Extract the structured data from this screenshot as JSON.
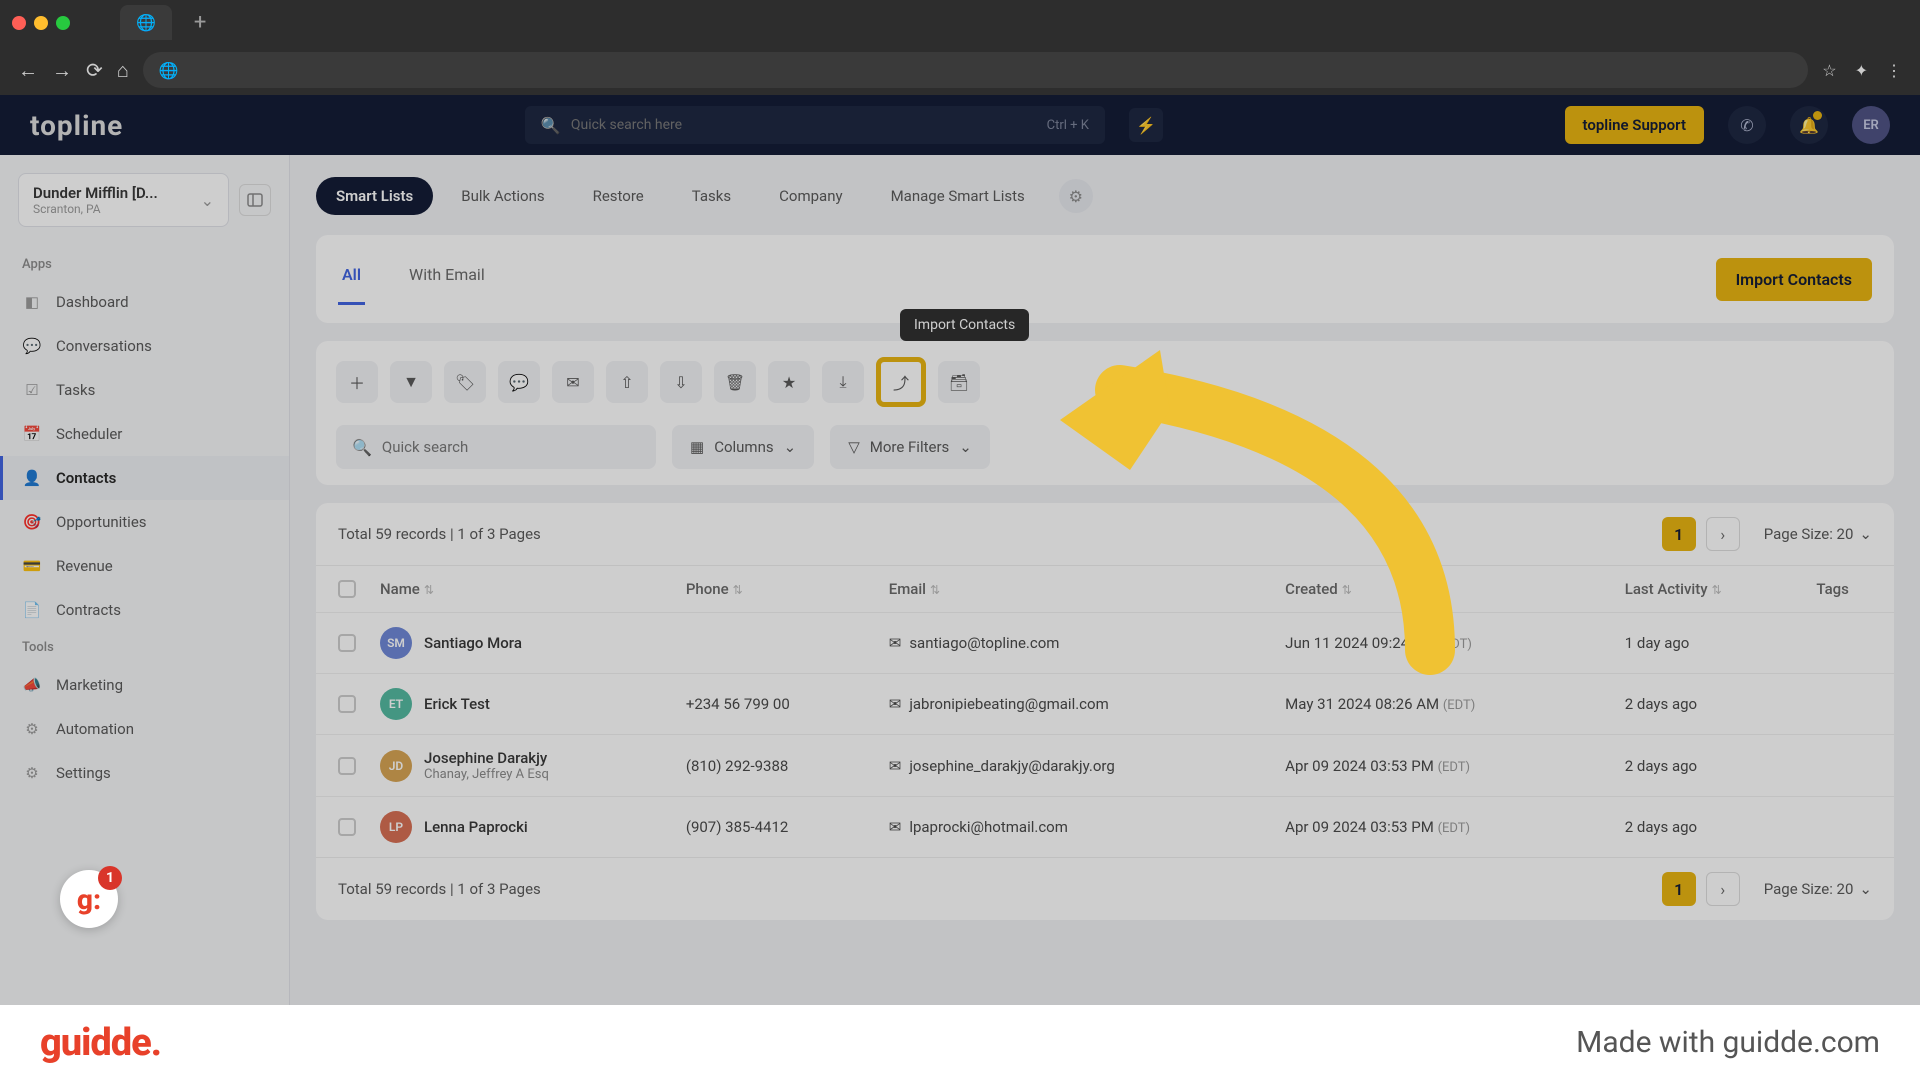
{
  "browser": {
    "new_tab": "+"
  },
  "header": {
    "logo": "topline",
    "search_placeholder": "Quick search here",
    "shortcut": "Ctrl + K",
    "support_label": "topline Support",
    "avatar_initials": "ER"
  },
  "sidebar": {
    "workspace": {
      "name": "Dunder Mifflin [D...",
      "subtitle": "Scranton, PA"
    },
    "section_apps": "Apps",
    "section_tools": "Tools",
    "items_apps": [
      "Dashboard",
      "Conversations",
      "Tasks",
      "Scheduler",
      "Contacts",
      "Opportunities",
      "Revenue",
      "Contracts"
    ],
    "items_tools": [
      "Marketing",
      "Automation",
      "Settings"
    ]
  },
  "tabs": {
    "smartlists": "Smart Lists",
    "bulk": "Bulk Actions",
    "restore": "Restore",
    "tasks": "Tasks",
    "company": "Company",
    "manage": "Manage Smart Lists"
  },
  "subtabs": {
    "all": "All",
    "with_email": "With Email",
    "import": "Import Contacts"
  },
  "toolbar": {
    "tooltip": "Import Contacts",
    "quicksearch_placeholder": "Quick search",
    "columns": "Columns",
    "more_filters": "More Filters"
  },
  "records": {
    "total_text": "Total 59 records  |  1 of 3 Pages",
    "page_current": "1",
    "page_size_label": "Page Size: 20"
  },
  "columns": {
    "name": "Name",
    "phone": "Phone",
    "email": "Email",
    "created": "Created",
    "last_activity": "Last Activity",
    "tags": "Tags"
  },
  "rows": [
    {
      "initials": "SM",
      "color": "#6b85d6",
      "name": "Santiago Mora",
      "sub": "",
      "phone": "",
      "email": "santiago@topline.com",
      "created": "Jun 11 2024 09:24 AM",
      "tz": "(EDT)",
      "last": "1 day ago"
    },
    {
      "initials": "ET",
      "color": "#4fb89e",
      "name": "Erick Test",
      "sub": "",
      "phone": "+234 56 799 00",
      "email": "jabronipiebeating@gmail.com",
      "created": "May 31 2024 08:26 AM",
      "tz": "(EDT)",
      "last": "2 days ago"
    },
    {
      "initials": "JD",
      "color": "#d6a24f",
      "name": "Josephine Darakjy",
      "sub": "Chanay, Jeffrey A Esq",
      "phone": "(810) 292-9388",
      "email": "josephine_darakjy@darakjy.org",
      "created": "Apr 09 2024 03:53 PM",
      "tz": "(EDT)",
      "last": "2 days ago"
    },
    {
      "initials": "LP",
      "color": "#d66b4f",
      "name": "Lenna Paprocki",
      "sub": "",
      "phone": "(907) 385-4412",
      "email": "lpaprocki@hotmail.com",
      "created": "Apr 09 2024 03:53 PM",
      "tz": "(EDT)",
      "last": "2 days ago"
    }
  ],
  "guidde": {
    "logo": "guidde.",
    "made": "Made with guidde.com",
    "badge_count": "1"
  }
}
